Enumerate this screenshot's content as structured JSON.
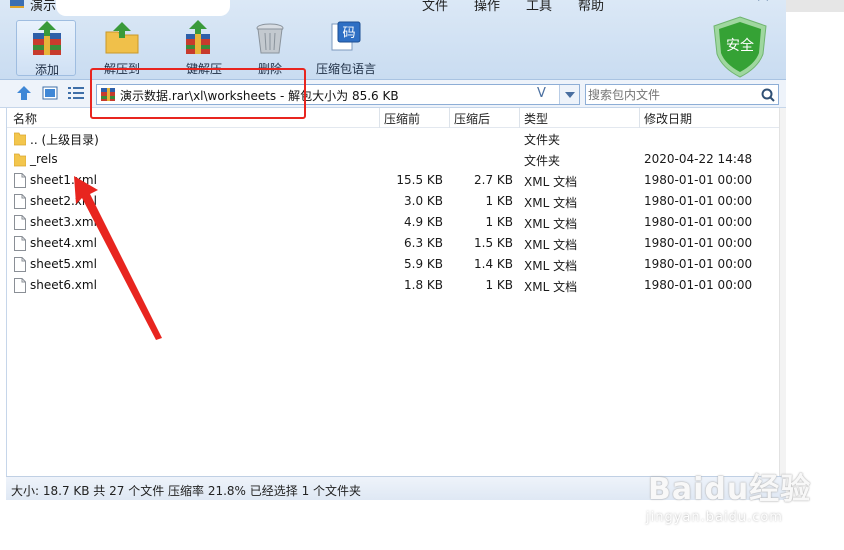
{
  "window": {
    "title": "演示",
    "menus": [
      "文件",
      "操作",
      "工具",
      "帮助"
    ]
  },
  "toolbar": {
    "buttons": [
      {
        "label": "添加",
        "icon": "add-archive-icon"
      },
      {
        "label": "解压到",
        "icon": "extract-to-icon"
      },
      {
        "label": "一键解压",
        "icon": "one-click-extract-icon"
      },
      {
        "label": "删除",
        "icon": "trash-can-icon"
      },
      {
        "label": "压缩包语言",
        "icon": "archive-encoding-icon"
      }
    ],
    "encoding_glyph": "码",
    "security_label": "安全"
  },
  "address": {
    "path": "演示数据.rar\\xl\\worksheets - 解包大小为 85.6 KB",
    "history_glyph": "V"
  },
  "search": {
    "placeholder": "搜索包内文件"
  },
  "list": {
    "columns": [
      "名称",
      "压缩前",
      "压缩后",
      "类型",
      "修改日期"
    ],
    "rows": [
      {
        "name": ".. (上级目录)",
        "packed": "",
        "size": "",
        "type": "文件夹",
        "modified": "",
        "kind": "folder"
      },
      {
        "name": "_rels",
        "packed": "",
        "size": "",
        "type": "文件夹",
        "modified": "2020-04-22 14:48",
        "kind": "folder"
      },
      {
        "name": "sheet1.xml",
        "packed": "15.5 KB",
        "size": "2.7 KB",
        "type": "XML 文档",
        "modified": "1980-01-01 00:00",
        "kind": "file"
      },
      {
        "name": "sheet2.xml",
        "packed": "3.0 KB",
        "size": "1 KB",
        "type": "XML 文档",
        "modified": "1980-01-01 00:00",
        "kind": "file"
      },
      {
        "name": "sheet3.xml",
        "packed": "4.9 KB",
        "size": "1 KB",
        "type": "XML 文档",
        "modified": "1980-01-01 00:00",
        "kind": "file"
      },
      {
        "name": "sheet4.xml",
        "packed": "6.3 KB",
        "size": "1.5 KB",
        "type": "XML 文档",
        "modified": "1980-01-01 00:00",
        "kind": "file"
      },
      {
        "name": "sheet5.xml",
        "packed": "5.9 KB",
        "size": "1.4 KB",
        "type": "XML 文档",
        "modified": "1980-01-01 00:00",
        "kind": "file"
      },
      {
        "name": "sheet6.xml",
        "packed": "1.8 KB",
        "size": "1 KB",
        "type": "XML 文档",
        "modified": "1980-01-01 00:00",
        "kind": "file"
      }
    ]
  },
  "status": {
    "text": "大小: 18.7 KB 共 27 个文件 压缩率 21.8% 已经选择 1 个文件夹"
  },
  "watermark": {
    "logo": "Baidu经验",
    "url": "jingyan.baidu.com"
  },
  "colors": {
    "annotation_red": "#e8251f",
    "toolbar_bg": "#c9dcf1",
    "shield_green": "#3aa53a"
  }
}
